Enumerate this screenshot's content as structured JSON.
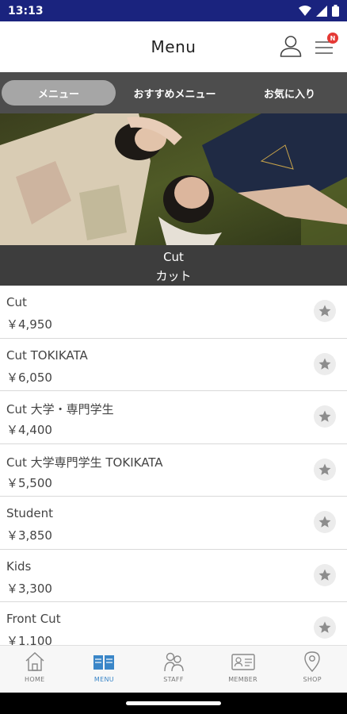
{
  "status_bar": {
    "time": "13:13",
    "icons": [
      "wifi-icon",
      "signal-icon",
      "battery-icon"
    ]
  },
  "header": {
    "title": "Menu",
    "user_icon": "user-icon",
    "menu_icon": "hamburger-icon",
    "badge": "N"
  },
  "tabs": [
    {
      "label": "メニュー",
      "active": true
    },
    {
      "label": "おすすめメニュー",
      "active": false
    },
    {
      "label": "お気に入り",
      "active": false
    }
  ],
  "category": {
    "name_en": "Cut",
    "name_ja": "カット"
  },
  "menu_items": [
    {
      "name": "Cut",
      "price": "￥4,950"
    },
    {
      "name": "Cut TOKIKATA",
      "price": "￥6,050"
    },
    {
      "name": "Cut 大学・専門学生",
      "price": "￥4,400"
    },
    {
      "name": "Cut 大学専門学生 TOKIKATA",
      "price": "￥5,500"
    },
    {
      "name": "Student",
      "price": "￥3,850"
    },
    {
      "name": "Kids",
      "price": "￥3,300"
    },
    {
      "name": "Front Cut",
      "price": "￥1,100"
    }
  ],
  "bottom_nav": [
    {
      "label": "HOME",
      "icon": "home-icon",
      "active": false
    },
    {
      "label": "MENU",
      "icon": "book-icon",
      "active": true
    },
    {
      "label": "STAFF",
      "icon": "staff-icon",
      "active": false
    },
    {
      "label": "MEMBER",
      "icon": "member-card-icon",
      "active": false
    },
    {
      "label": "SHOP",
      "icon": "map-pin-icon",
      "active": false
    }
  ],
  "colors": {
    "status_bar": "#1a237e",
    "tab_bar": "#4d4d4d",
    "tab_active": "#a6a6a6",
    "category_bar": "#3d3d3d",
    "nav_active": "#3a86c8",
    "badge": "#e53935"
  }
}
